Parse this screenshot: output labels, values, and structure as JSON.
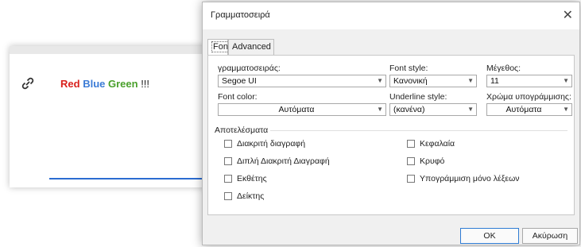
{
  "background_editor": {
    "word_red": "Red",
    "word_blue": "Blue",
    "word_green": "Green",
    "marks": "!!!"
  },
  "dialog": {
    "title": "Γραμματοσειρά",
    "close_glyph": "✕",
    "tabs": [
      {
        "label": "Font"
      },
      {
        "label": "Advanced"
      }
    ],
    "font": {
      "label": "γραμματοσειράς:",
      "value": "Segoe UI"
    },
    "font_style": {
      "label": "Font style:",
      "value": "Κανονική"
    },
    "size": {
      "label": "Μέγεθος:",
      "value": "11"
    },
    "font_color": {
      "label": "Font color:",
      "value": "Αυτόματα"
    },
    "underline_style": {
      "label": "Underline style:",
      "value": "(κανένα)"
    },
    "underline_color": {
      "label": "Χρώμα υπογράμμισης:",
      "value": "Αυτόματα"
    },
    "effects": {
      "title": "Αποτελέσματα",
      "left": [
        {
          "label": "Διακριτή διαγραφή"
        },
        {
          "label": "Διπλή Διακριτή Διαγραφή"
        },
        {
          "label": "Εκθέτης"
        },
        {
          "label": "Δείκτης"
        }
      ],
      "right": [
        {
          "label": "Κεφαλαία"
        },
        {
          "label": "Κρυφό"
        },
        {
          "label": "Υπογράμμιση μόνο λέξεων"
        }
      ]
    },
    "ok_label": "OK",
    "cancel_label": "Ακύρωση"
  },
  "colors": {
    "red": "#d9201c",
    "blue": "#3b7bd6",
    "green": "#4aa02c",
    "accent": "#2b6cd1"
  }
}
